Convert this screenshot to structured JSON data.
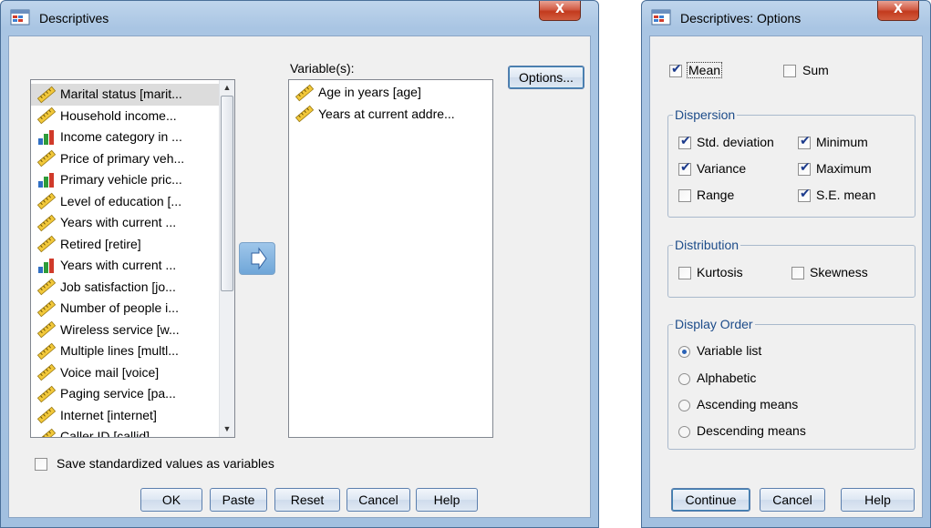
{
  "descriptives": {
    "title": "Descriptives",
    "close_label": "X",
    "source_list": [
      {
        "label": "Marital status [marit...",
        "type": "scale",
        "selected": true
      },
      {
        "label": "Household income...",
        "type": "scale"
      },
      {
        "label": "Income category in ...",
        "type": "ordinal"
      },
      {
        "label": "Price of primary veh...",
        "type": "scale"
      },
      {
        "label": "Primary vehicle pric...",
        "type": "ordinal"
      },
      {
        "label": "Level of education [...",
        "type": "scale"
      },
      {
        "label": "Years with current ...",
        "type": "scale"
      },
      {
        "label": "Retired [retire]",
        "type": "scale"
      },
      {
        "label": "Years with current ...",
        "type": "ordinal"
      },
      {
        "label": "Job satisfaction [jo...",
        "type": "scale"
      },
      {
        "label": "Number of people i...",
        "type": "scale"
      },
      {
        "label": "Wireless service [w...",
        "type": "scale"
      },
      {
        "label": "Multiple lines [multl...",
        "type": "scale"
      },
      {
        "label": "Voice mail [voice]",
        "type": "scale"
      },
      {
        "label": "Paging service [pa...",
        "type": "scale"
      },
      {
        "label": "Internet [internet]",
        "type": "scale"
      },
      {
        "label": "Caller ID [callid]",
        "type": "scale"
      }
    ],
    "variables_label": "Variable(s):",
    "variables": [
      {
        "label": "Age in years [age]",
        "type": "scale"
      },
      {
        "label": "Years at current addre...",
        "type": "scale"
      }
    ],
    "options_button": "Options...",
    "save_standardized_label": "Save standardized values as variables",
    "save_standardized_checked": false,
    "buttons": {
      "ok": "OK",
      "paste": "Paste",
      "reset": "Reset",
      "cancel": "Cancel",
      "help": "Help"
    }
  },
  "options": {
    "title": "Descriptives: Options",
    "close_label": "X",
    "mean_label": "Mean",
    "mean_checked": true,
    "sum_label": "Sum",
    "sum_checked": false,
    "dispersion": {
      "title": "Dispersion",
      "std_deviation": {
        "label": "Std. deviation",
        "checked": true
      },
      "variance": {
        "label": "Variance",
        "checked": true
      },
      "range": {
        "label": "Range",
        "checked": false
      },
      "minimum": {
        "label": "Minimum",
        "checked": true
      },
      "maximum": {
        "label": "Maximum",
        "checked": true
      },
      "se_mean": {
        "label": "S.E. mean",
        "checked": true
      }
    },
    "distribution": {
      "title": "Distribution",
      "kurtosis": {
        "label": "Kurtosis",
        "checked": false
      },
      "skewness": {
        "label": "Skewness",
        "checked": false
      }
    },
    "display_order": {
      "title": "Display Order",
      "selected": "Variable list",
      "items": [
        "Variable list",
        "Alphabetic",
        "Ascending means",
        "Descending means"
      ]
    },
    "buttons": {
      "continue": "Continue",
      "cancel": "Cancel",
      "help": "Help"
    }
  }
}
